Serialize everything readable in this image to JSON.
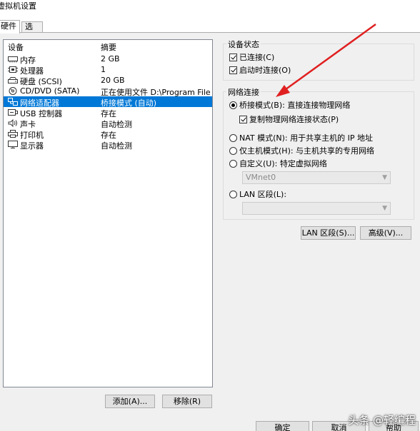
{
  "window": {
    "title": "虚拟机设置"
  },
  "tabs": [
    {
      "label": "硬件",
      "active": true
    },
    {
      "label": "选项",
      "active": false
    }
  ],
  "device_list": {
    "headers": {
      "device": "设备",
      "summary": "摘要"
    },
    "rows": [
      {
        "icon": "memory-icon",
        "device": "内存",
        "summary": "2 GB",
        "selected": false
      },
      {
        "icon": "cpu-icon",
        "device": "处理器",
        "summary": "1",
        "selected": false
      },
      {
        "icon": "harddisk-icon",
        "device": "硬盘 (SCSI)",
        "summary": "20 GB",
        "selected": false
      },
      {
        "icon": "cd-dvd-icon",
        "device": "CD/DVD (SATA)",
        "summary": "正在使用文件 D:\\Program Files ...",
        "selected": false
      },
      {
        "icon": "network-adapter-icon",
        "device": "网络适配器",
        "summary": "桥接模式 (自动)",
        "selected": true
      },
      {
        "icon": "usb-icon",
        "device": "USB 控制器",
        "summary": "存在",
        "selected": false
      },
      {
        "icon": "sound-card-icon",
        "device": "声卡",
        "summary": "自动检测",
        "selected": false
      },
      {
        "icon": "printer-icon",
        "device": "打印机",
        "summary": "存在",
        "selected": false
      },
      {
        "icon": "display-icon",
        "device": "显示器",
        "summary": "自动检测",
        "selected": false
      }
    ]
  },
  "list_buttons": {
    "add": "添加(A)...",
    "remove": "移除(R)"
  },
  "device_status": {
    "title": "设备状态",
    "connected": {
      "label": "已连接(C)",
      "checked": true
    },
    "connect_at_power_on": {
      "label": "启动时连接(O)",
      "checked": true
    }
  },
  "network_connection": {
    "title": "网络连接",
    "bridged": {
      "label": "桥接模式(B): 直接连接物理网络",
      "selected": true
    },
    "replicate": {
      "label": "复制物理网络连接状态(P)",
      "checked": true
    },
    "nat": {
      "label": "NAT 模式(N): 用于共享主机的 IP 地址",
      "selected": false
    },
    "host_only": {
      "label": "仅主机模式(H): 与主机共享的专用网络",
      "selected": false
    },
    "custom": {
      "label": "自定义(U): 特定虚拟网络",
      "selected": false
    },
    "custom_value": "VMnet0",
    "lan_segment": {
      "label": "LAN 区段(L):",
      "selected": false
    },
    "lan_segment_value": ""
  },
  "network_buttons": {
    "lan_segments": "LAN 区段(S)...",
    "advanced": "高级(V)..."
  },
  "dialog_buttons": {
    "ok": "确定",
    "cancel": "取消",
    "help": "帮助"
  },
  "watermark": "头条 @轻编程",
  "colors": {
    "selection": "#0078d7",
    "annotation_arrow": "#e02020"
  }
}
